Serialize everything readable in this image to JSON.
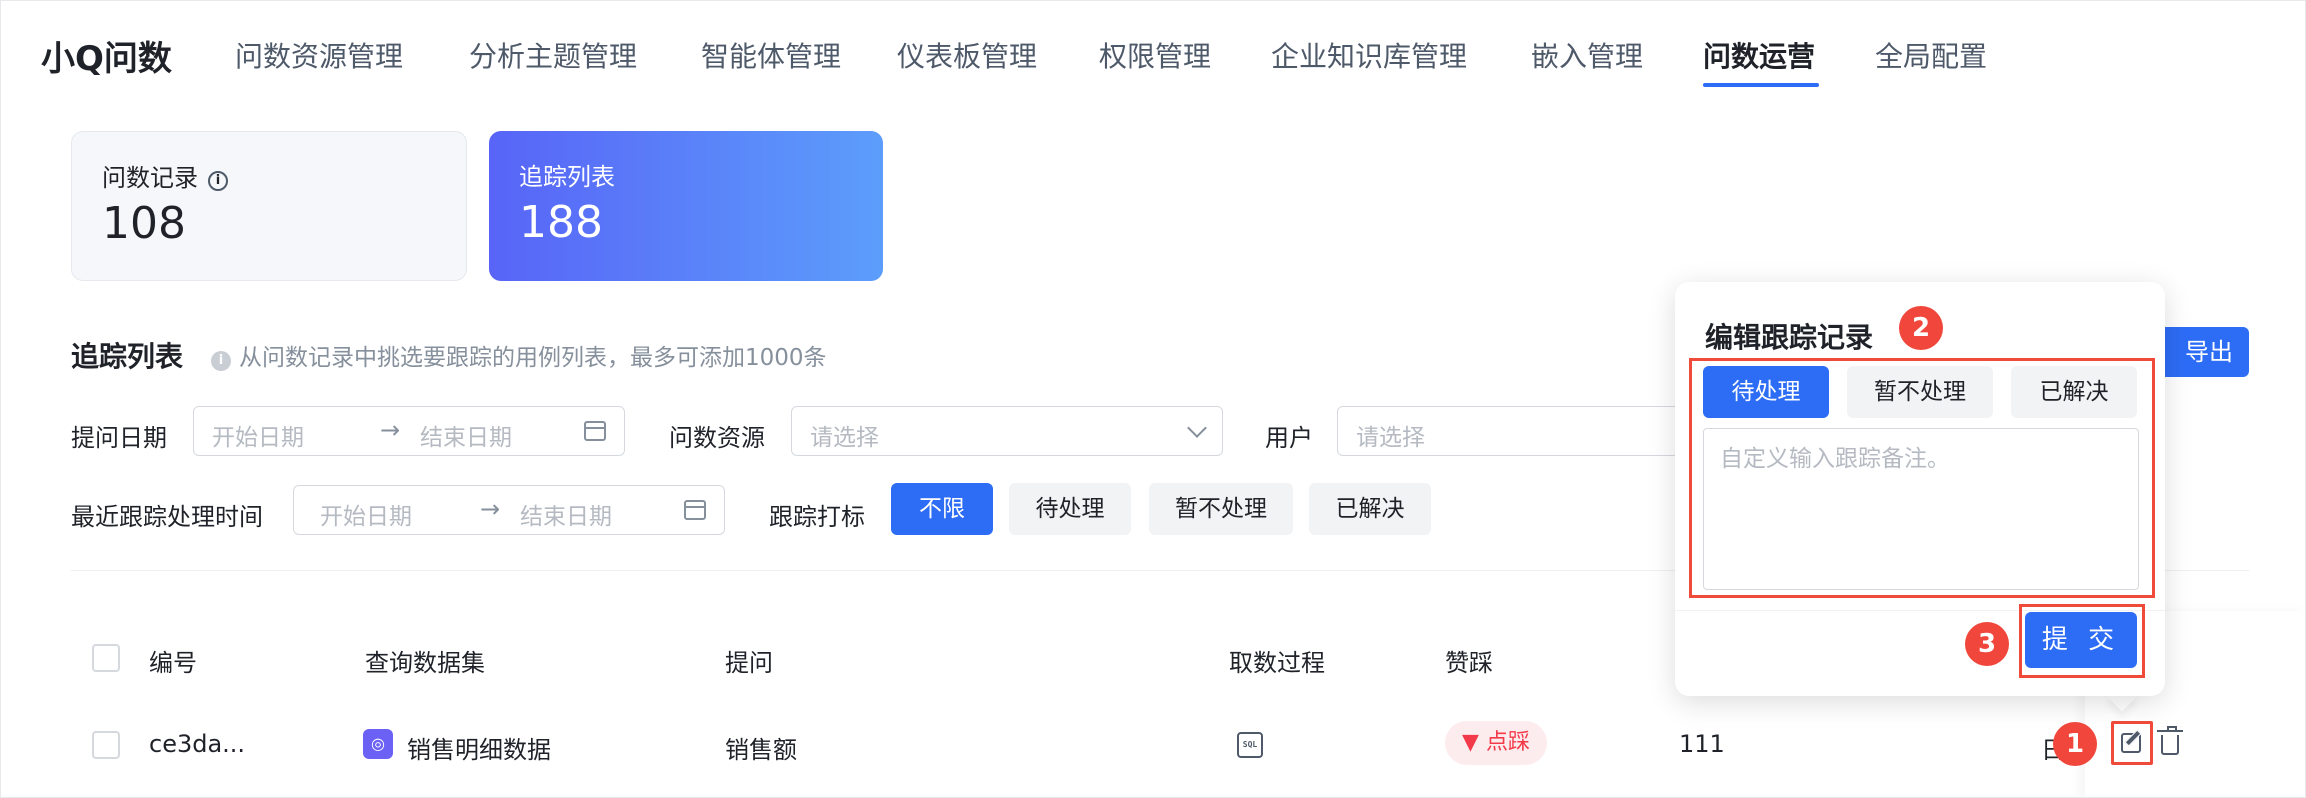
{
  "app": {
    "brand": "小Q问数"
  },
  "nav": {
    "items": [
      {
        "label": "问数资源管理"
      },
      {
        "label": "分析主题管理"
      },
      {
        "label": "智能体管理"
      },
      {
        "label": "仪表板管理"
      },
      {
        "label": "权限管理"
      },
      {
        "label": "企业知识库管理"
      },
      {
        "label": "嵌入管理"
      },
      {
        "label": "问数运营"
      },
      {
        "label": "全局配置"
      }
    ],
    "active": "问数运营"
  },
  "stats": {
    "records": {
      "label": "问数记录",
      "value": "108"
    },
    "tracking": {
      "label": "追踪列表",
      "value": "188"
    }
  },
  "section": {
    "title": "追踪列表",
    "hint": "从问数记录中挑选要跟踪的用例列表，最多可添加1000条",
    "export_label": "导出"
  },
  "filters": {
    "ask_date": {
      "label": "提问日期",
      "start_placeholder": "开始日期",
      "end_placeholder": "结束日期"
    },
    "resource": {
      "label": "问数资源",
      "placeholder": "请选择"
    },
    "user": {
      "label": "用户",
      "placeholder": "请选择"
    },
    "recent_time": {
      "label": "最近跟踪处理时间",
      "start_placeholder": "开始日期",
      "end_placeholder": "结束日期"
    },
    "mark": {
      "label": "跟踪打标",
      "options": [
        "不限",
        "待处理",
        "暂不处理",
        "已解决"
      ],
      "selected": "不限"
    }
  },
  "table": {
    "headers": [
      "编号",
      "查询数据集",
      "提问",
      "取数过程",
      "赞踩"
    ],
    "rows": [
      {
        "id": "ce3da...",
        "dataset": "销售明细数据",
        "question": "销售额",
        "process_icon": "sql-icon",
        "vote": "点踩",
        "extra": "111",
        "action_text": "日"
      }
    ]
  },
  "popover": {
    "title": "编辑跟踪记录",
    "options": [
      "待处理",
      "暂不处理",
      "已解决"
    ],
    "selected": "待处理",
    "placeholder": "自定义输入跟踪备注。",
    "submit_label": "提 交"
  },
  "steps": [
    "1",
    "2",
    "3"
  ],
  "colors": {
    "primary": "#2d6df6",
    "annotation": "#f04a3a",
    "dislike": "#f23a4a"
  }
}
